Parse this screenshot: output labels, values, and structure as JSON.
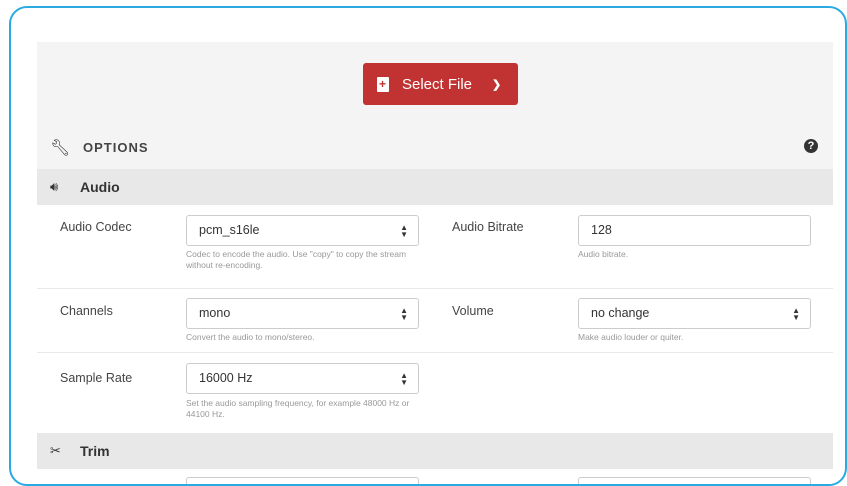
{
  "header": {
    "select_file_label": "Select File"
  },
  "options": {
    "title": "OPTIONS",
    "help_glyph": "?"
  },
  "audio": {
    "title": "Audio",
    "codec": {
      "label": "Audio Codec",
      "value": "pcm_s16le",
      "help": "Codec to encode the audio. Use \"copy\" to copy the stream without re-encoding."
    },
    "bitrate": {
      "label": "Audio Bitrate",
      "value": "128",
      "help": "Audio bitrate."
    },
    "channels": {
      "label": "Channels",
      "value": "mono",
      "help": "Convert the audio to mono/stereo."
    },
    "volume": {
      "label": "Volume",
      "value": "no change",
      "help": "Make audio louder or quiter."
    },
    "sample_rate": {
      "label": "Sample Rate",
      "value": "16000 Hz",
      "help": "Set the audio sampling frequency, for example 48000 Hz or 44100 Hz."
    }
  },
  "trim": {
    "title": "Trim"
  },
  "icons": {
    "file": "file-plus-icon",
    "chevron": "chevron-down-icon",
    "wrench": "wrench-icon",
    "help": "question-circle-icon",
    "audio": "volume-icon",
    "trim": "scissors-icon",
    "select_arrows": "sort-arrows-icon"
  },
  "colors": {
    "accent_border": "#29abe2",
    "button": "#c13333",
    "panel_bg": "#f4f4f4",
    "section_bg": "#e8e8e8"
  }
}
